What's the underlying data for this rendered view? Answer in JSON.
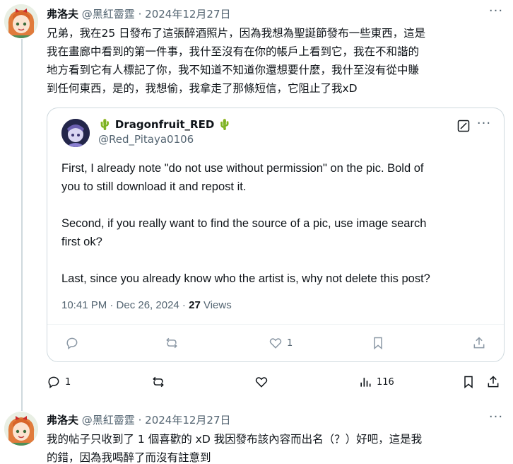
{
  "tweet1": {
    "display_name": "弗洛夫",
    "handle": "@黑紅霤霆",
    "separator": "·",
    "date": "2024年12月27日",
    "lines": [
      "兄弟，我在25 日發布了這張醉酒照片，因為我想為聖誕節發布一些東西，這是",
      "我在畫廊中看到的第一件事，我什至沒有在你的帳戶上看到它，我在不和諧的",
      "地方看到它有人標記了你，我不知道不知道你還想要什麼，我什至沒有從中賺",
      "到任何東西，是的，我想偷，我拿走了那條短信，它阻止了我xD"
    ],
    "more": "···"
  },
  "quote": {
    "display_name": "Dragonfruit_RED",
    "handle": "@Red_Pitaya0106",
    "paragraphs": [
      [
        "First, I already note \"do not use without permission\" on the pic. Bold of",
        "you to still download it and repost it."
      ],
      [
        "Second, if you really want to find the source of a pic, use image search",
        "first ok?"
      ],
      [
        "Last, since you already know who the artist is, why not delete this post?"
      ]
    ],
    "time": "10:41 PM · Dec 26, 2024 ·",
    "views_count": "27",
    "views_label": "Views",
    "more": "···",
    "actions": {
      "reply": "",
      "repost": "",
      "like": "1",
      "bookmark": "",
      "share": ""
    }
  },
  "tweet1_actions": {
    "reply": "1",
    "repost": "",
    "like": "",
    "views": "116",
    "bookmark": "",
    "share": ""
  },
  "tweet2": {
    "display_name": "弗洛夫",
    "handle": "@黑紅霤霆",
    "separator": "·",
    "date": "2024年12月27日",
    "lines": [
      "我的帖子只收到了 1 個喜歡的 xD 我因發布該內容而出名（？）好吧，這是我",
      "的錯，因為我喝醉了而沒有註意到"
    ],
    "more": "···"
  },
  "icons": {
    "reply": "reply-icon",
    "repost": "repost-icon",
    "like": "heart-icon",
    "views": "views-icon",
    "bookmark": "bookmark-icon",
    "share": "share-icon",
    "cactus": "cactus-emoji",
    "edit": "edit-icon"
  }
}
